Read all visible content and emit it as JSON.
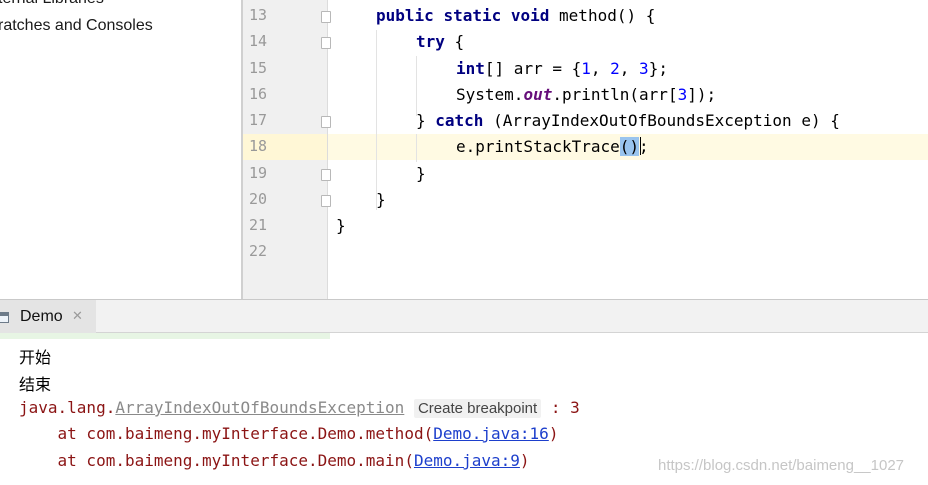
{
  "project_tree": {
    "items": [
      "ternal Libraries",
      "ratches and Consoles"
    ]
  },
  "editor": {
    "line_numbers": [
      "13",
      "14",
      "15",
      "16",
      "17",
      "18",
      "19",
      "20",
      "21",
      "22"
    ],
    "code": {
      "public": "public",
      "static": "static",
      "void": "void",
      "method_sig": " method() {",
      "try": "try",
      "try_brace": " {",
      "int": "int",
      "arr_decl_a": "[] arr = {",
      "n1": "1",
      "comma1": ", ",
      "n2": "2",
      "comma2": ", ",
      "n3": "3",
      "arr_decl_b": "};",
      "sys_a": "System.",
      "out": "out",
      "sys_b": ".println(arr[",
      "idx": "3",
      "sys_c": "]);",
      "catch_close": "} ",
      "catch": "catch",
      "catch_params": " (ArrayIndexOutOfBoundsException e) {",
      "trace_call": "e.printStackTrace",
      "trace_parens": "()",
      "trace_end": ";",
      "close_catch": "}",
      "close_method": "}",
      "close_class": "}"
    }
  },
  "run_panel": {
    "tab_label": "Demo",
    "tab_close": "✕",
    "output": {
      "line1": "开始",
      "line2": "结束",
      "exc_prefix": "java.lang.",
      "exc_name": "ArrayIndexOutOfBoundsException",
      "breakpoint_chip": "Create breakpoint",
      "exc_suffix": " : 3",
      "at1_prefix": "    at com.baimeng.myInterface.Demo.method(",
      "at1_link": "Demo.java:16",
      "at1_suffix": ")",
      "at2_prefix": "    at com.baimeng.myInterface.Demo.main(",
      "at2_link": "Demo.java:9",
      "at2_suffix": ")"
    },
    "watermark": "https://blog.csdn.net/baimeng__1027"
  },
  "colors": {
    "keyword": "#000080",
    "number": "#0000ff",
    "static_field": "#660e7a",
    "error_text": "#8b1414",
    "link": "#1d3fcc",
    "caret_line": "#fffae3",
    "paren_match": "#99c4ee"
  },
  "icons": [
    "run-console-icon",
    "close-icon",
    "fold-marker-icon"
  ]
}
